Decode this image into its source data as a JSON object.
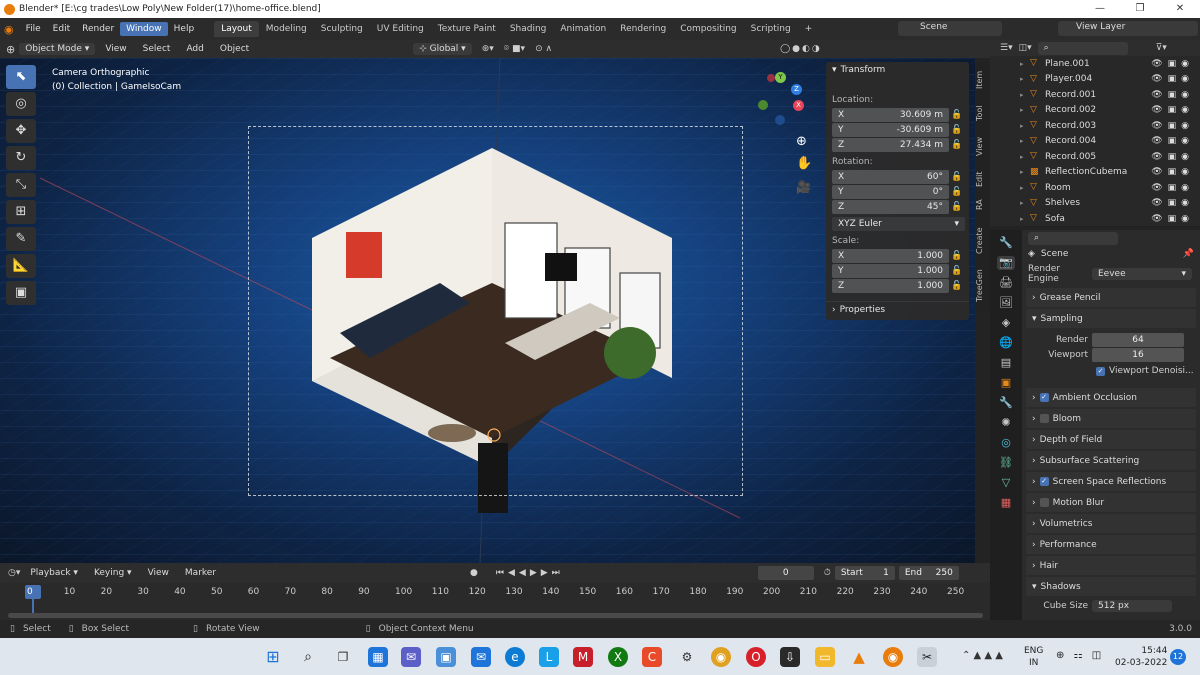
{
  "title": "Blender* [E:\\cg trades\\Low Poly\\New Folder(17)\\home-office.blend]",
  "menus": [
    "File",
    "Edit",
    "Render",
    "Window",
    "Help"
  ],
  "workspaces": [
    "Layout",
    "Modeling",
    "Sculpting",
    "UV Editing",
    "Texture Paint",
    "Shading",
    "Animation",
    "Rendering",
    "Compositing",
    "Scripting",
    "+"
  ],
  "scene": "Scene",
  "view_layer": "View Layer",
  "header": {
    "mode": "Object Mode",
    "view": "View",
    "select": "Select",
    "add": "Add",
    "object": "Object",
    "orientation": "Global"
  },
  "viewport": {
    "camera": "Camera Orthographic",
    "collection": "(0) Collection | GameIsoCam"
  },
  "transform": {
    "title": "Transform",
    "location_label": "Location:",
    "loc": [
      {
        "axis": "X",
        "value": "30.609 m"
      },
      {
        "axis": "Y",
        "value": "-30.609 m"
      },
      {
        "axis": "Z",
        "value": "27.434 m"
      }
    ],
    "rotation_label": "Rotation:",
    "rot": [
      {
        "axis": "X",
        "value": "60°"
      },
      {
        "axis": "Y",
        "value": "0°"
      },
      {
        "axis": "Z",
        "value": "45°"
      }
    ],
    "euler": "XYZ Euler",
    "scale_label": "Scale:",
    "scale": [
      {
        "axis": "X",
        "value": "1.000"
      },
      {
        "axis": "Y",
        "value": "1.000"
      },
      {
        "axis": "Z",
        "value": "1.000"
      }
    ],
    "properties": "Properties"
  },
  "ntabs": [
    "Item",
    "Tool",
    "View",
    "Edit",
    "RA",
    "Create",
    "TreeGen"
  ],
  "outliner": [
    "Plane.001",
    "Player.004",
    "Record.001",
    "Record.002",
    "Record.003",
    "Record.004",
    "Record.005",
    "ReflectionCubema",
    "Room",
    "Shelves",
    "Sofa"
  ],
  "props": {
    "scene": "Scene",
    "engine_label": "Render Engine",
    "engine": "Eevee",
    "grease": "Grease Pencil",
    "sampling": "Sampling",
    "render_label": "Render",
    "render_val": "64",
    "viewport_label": "Viewport",
    "viewport_val": "16",
    "denoise": "Viewport Denoisi...",
    "sections": [
      {
        "label": "Ambient Occlusion",
        "check": true
      },
      {
        "label": "Bloom",
        "check": false
      },
      {
        "label": "Depth of Field",
        "check": null
      },
      {
        "label": "Subsurface Scattering",
        "check": null
      },
      {
        "label": "Screen Space Reflections",
        "check": true
      },
      {
        "label": "Motion Blur",
        "check": false
      },
      {
        "label": "Volumetrics",
        "check": null
      },
      {
        "label": "Performance",
        "check": null
      },
      {
        "label": "Hair",
        "check": null
      },
      {
        "label": "Shadows",
        "check": null
      }
    ],
    "cube_label": "Cube Size",
    "cube_val": "512 px"
  },
  "timeline": {
    "playback": "Playback",
    "keying": "Keying",
    "view": "View",
    "marker": "Marker",
    "frame": "0",
    "start_label": "Start",
    "start": "1",
    "end_label": "End",
    "end": "250",
    "ticks": [
      "0",
      "10",
      "20",
      "30",
      "40",
      "50",
      "60",
      "70",
      "80",
      "90",
      "100",
      "110",
      "120",
      "130",
      "140",
      "150",
      "160",
      "170",
      "180",
      "190",
      "200",
      "210",
      "220",
      "230",
      "240",
      "250"
    ]
  },
  "status": {
    "select": "Select",
    "box": "Box Select",
    "rotate": "Rotate View",
    "context": "Object Context Menu",
    "version": "3.0.0"
  },
  "taskbar": {
    "lang1": "ENG",
    "lang2": "IN",
    "time": "15:44",
    "date": "02-03-2022",
    "notif": "12"
  }
}
